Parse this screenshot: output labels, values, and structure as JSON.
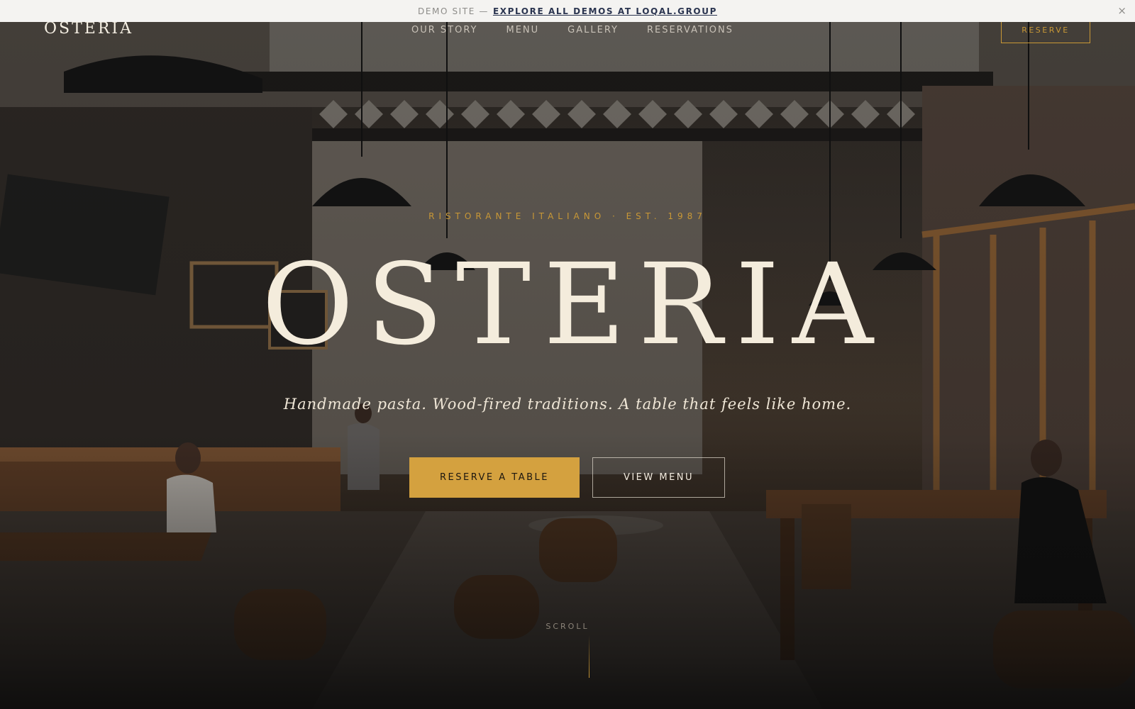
{
  "demo_bar": {
    "prefix": "DEMO SITE —",
    "link": "EXPLORE ALL DEMOS AT LOQAL.GROUP",
    "close": "×"
  },
  "nav": {
    "logo": "OSTERIA",
    "links": [
      "OUR STORY",
      "MENU",
      "GALLERY",
      "RESERVATIONS"
    ],
    "reserve": "RESERVE"
  },
  "hero": {
    "eyebrow": "RISTORANTE ITALIANO · EST. 1987",
    "title": "OSTERIA",
    "tagline": "Handmade pasta. Wood-fired traditions. A table that feels like home.",
    "primary_button": "RESERVE A TABLE",
    "secondary_button": "VIEW MENU",
    "scroll": "SCROLL"
  },
  "colors": {
    "accent": "#d4a13f",
    "title": "#f4ecdc",
    "demo_bar_bg": "#f4f3f1",
    "demo_link": "#2b3550"
  }
}
